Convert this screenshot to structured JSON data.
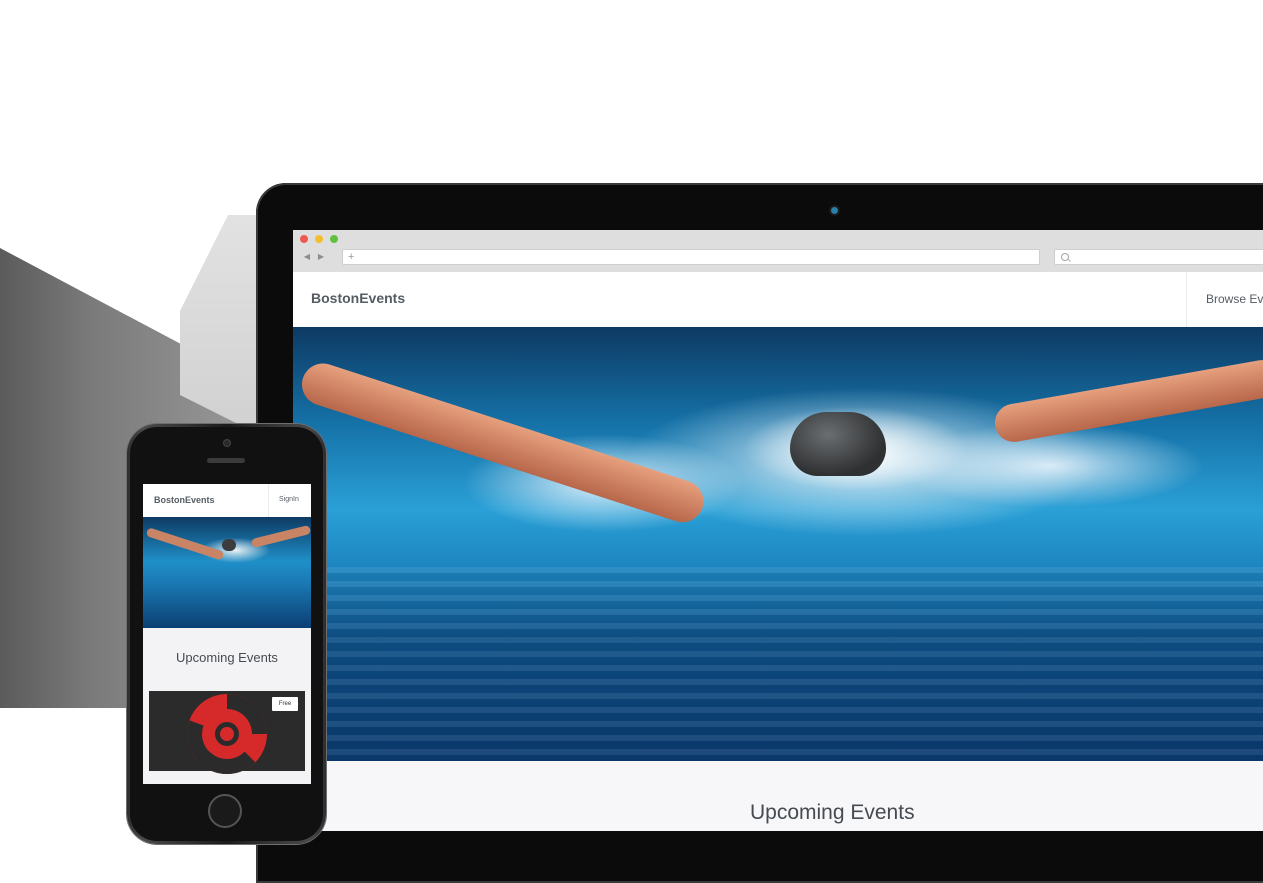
{
  "laptop": {
    "browser": {
      "back_glyph": "◀",
      "forward_glyph": "▶",
      "new_tab_glyph": "+",
      "address_value": ""
    },
    "site": {
      "brand": "BostonEvents",
      "nav_link": "Browse Ev",
      "section_title": "Upcoming Events"
    }
  },
  "phone": {
    "site": {
      "brand": "BostonEvents",
      "signin": "SignIn",
      "section_title": "Upcoming Events",
      "card_badge": "Free"
    }
  },
  "colors": {
    "brand_text": "#555c63",
    "hero_water": "#1c84bf",
    "event_logo": "#d62a2a"
  }
}
